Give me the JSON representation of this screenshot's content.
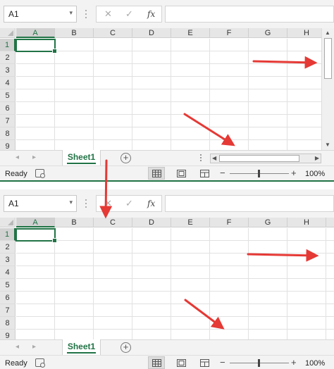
{
  "colors": {
    "accent": "#217346",
    "arrow": "#e53935"
  },
  "panels": [
    {
      "name_box": {
        "value": "A1"
      },
      "formula": {
        "cancel_icon": "✕",
        "enter_icon": "✓",
        "fx_label": "fx",
        "value": ""
      },
      "columns": [
        "A",
        "B",
        "C",
        "D",
        "E",
        "F",
        "G",
        "H"
      ],
      "rows": [
        "1",
        "2",
        "3",
        "4",
        "5",
        "6",
        "7",
        "8",
        "9"
      ],
      "selected_cell": "A1",
      "vertical_scrollbar": true,
      "sheet_tabs": [
        {
          "label": "Sheet1",
          "active": true
        }
      ],
      "status": {
        "mode": "Ready",
        "zoom": "100%"
      }
    },
    {
      "name_box": {
        "value": "A1"
      },
      "formula": {
        "cancel_icon": "✕",
        "enter_icon": "✓",
        "fx_label": "fx",
        "value": ""
      },
      "columns": [
        "A",
        "B",
        "C",
        "D",
        "E",
        "F",
        "G",
        "H"
      ],
      "rows": [
        "1",
        "2",
        "3",
        "4",
        "5",
        "6",
        "7",
        "8",
        "9"
      ],
      "selected_cell": "A1",
      "vertical_scrollbar": false,
      "sheet_tabs": [
        {
          "label": "Sheet1",
          "active": true
        }
      ],
      "status": {
        "mode": "Ready",
        "zoom": "100%"
      }
    }
  ],
  "icons": {
    "name_box_dropdown": "chevron-down-icon",
    "add_sheet": "plus-circle-icon",
    "macro": "macro-record-icon",
    "normal_view": "normal-view-icon",
    "page_layout_view": "page-layout-view-icon",
    "page_break_view": "page-break-preview-icon"
  }
}
